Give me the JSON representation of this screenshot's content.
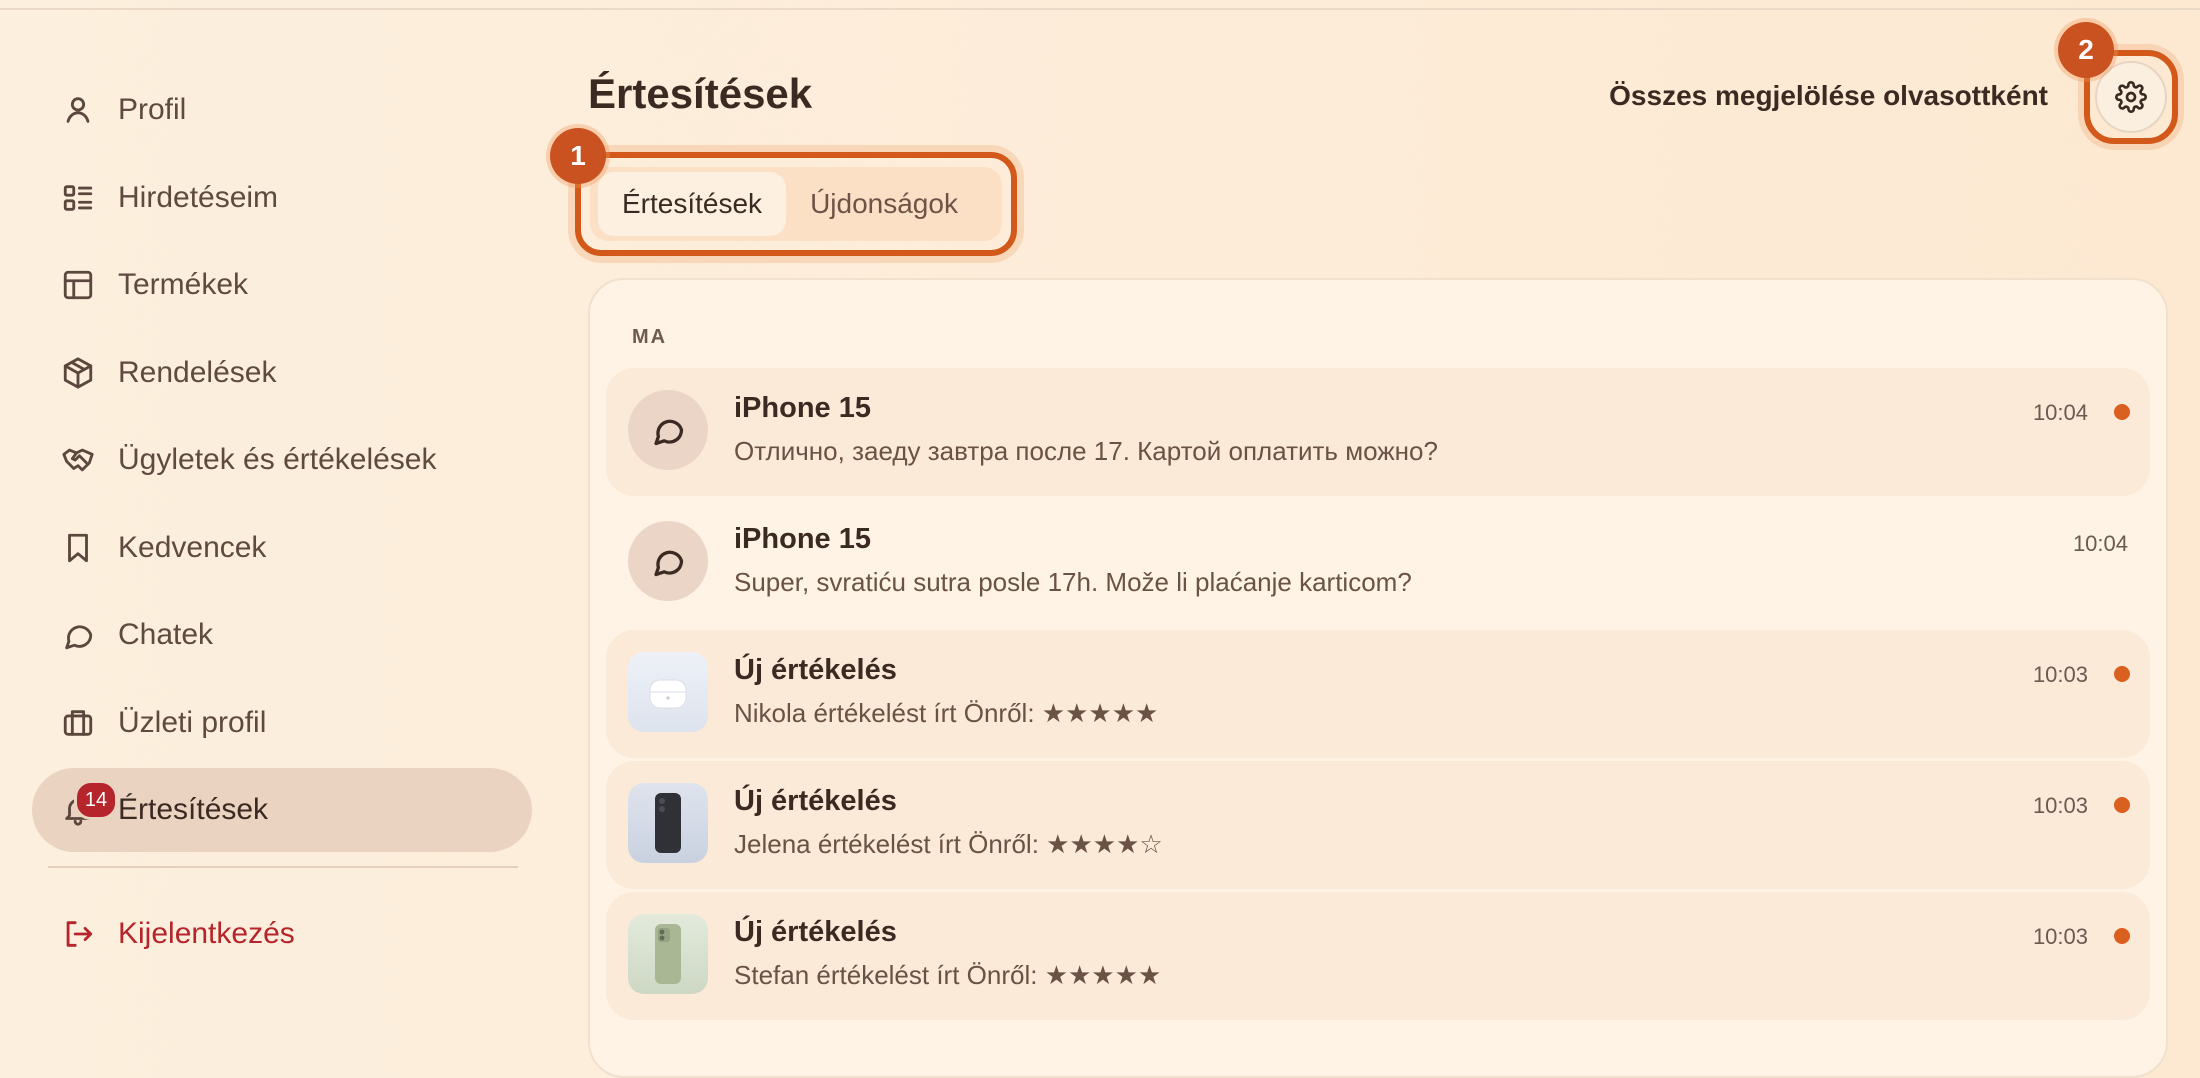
{
  "sidebar": {
    "items": [
      {
        "label": "Profil",
        "icon": "user-icon"
      },
      {
        "label": "Hirdetéseim",
        "icon": "list-icon"
      },
      {
        "label": "Termékek",
        "icon": "table-icon"
      },
      {
        "label": "Rendelések",
        "icon": "package-icon"
      },
      {
        "label": "Ügyletek és értékelések",
        "icon": "handshake-icon"
      },
      {
        "label": "Kedvencek",
        "icon": "bookmark-icon"
      },
      {
        "label": "Chatek",
        "icon": "chat-icon"
      },
      {
        "label": "Üzleti profil",
        "icon": "briefcase-icon"
      },
      {
        "label": "Értesítések",
        "icon": "bell-icon",
        "badge": "14",
        "active": true
      }
    ],
    "logout": {
      "label": "Kijelentkezés",
      "icon": "logout-icon"
    }
  },
  "header": {
    "title": "Értesítések",
    "mark_all": "Összes megjelölése olvasottként",
    "settings_icon": "gear-icon"
  },
  "tabs": [
    {
      "label": "Értesítések",
      "active": true
    },
    {
      "label": "Újdonságok",
      "active": false
    }
  ],
  "steps": {
    "one": "1",
    "two": "2"
  },
  "list": {
    "section": "MA",
    "items": [
      {
        "title": "iPhone 15",
        "text": "Отлично, заеду завтра после 17. Картой оплатить можно?",
        "time": "10:04",
        "unread": true,
        "kind": "chat"
      },
      {
        "title": "iPhone 15",
        "text": "Super, svratiću sutra posle 17h. Može li plaćanje karticom?",
        "time": "10:04",
        "unread": false,
        "kind": "chat"
      },
      {
        "title": "Új értékelés",
        "text": "Nikola értékelést írt Önről: ★★★★★",
        "time": "10:03",
        "unread": true,
        "kind": "product-airpods"
      },
      {
        "title": "Új értékelés",
        "text": "Jelena értékelést írt Önről: ★★★★☆",
        "time": "10:03",
        "unread": true,
        "kind": "product-phone-dark"
      },
      {
        "title": "Új értékelés",
        "text": "Stefan értékelést írt Önről: ★★★★★",
        "time": "10:03",
        "unread": true,
        "kind": "product-phone-green"
      }
    ]
  },
  "colors": {
    "accent": "#d3591b",
    "badge": "#b5252b",
    "unread_dot": "#d9601f"
  }
}
